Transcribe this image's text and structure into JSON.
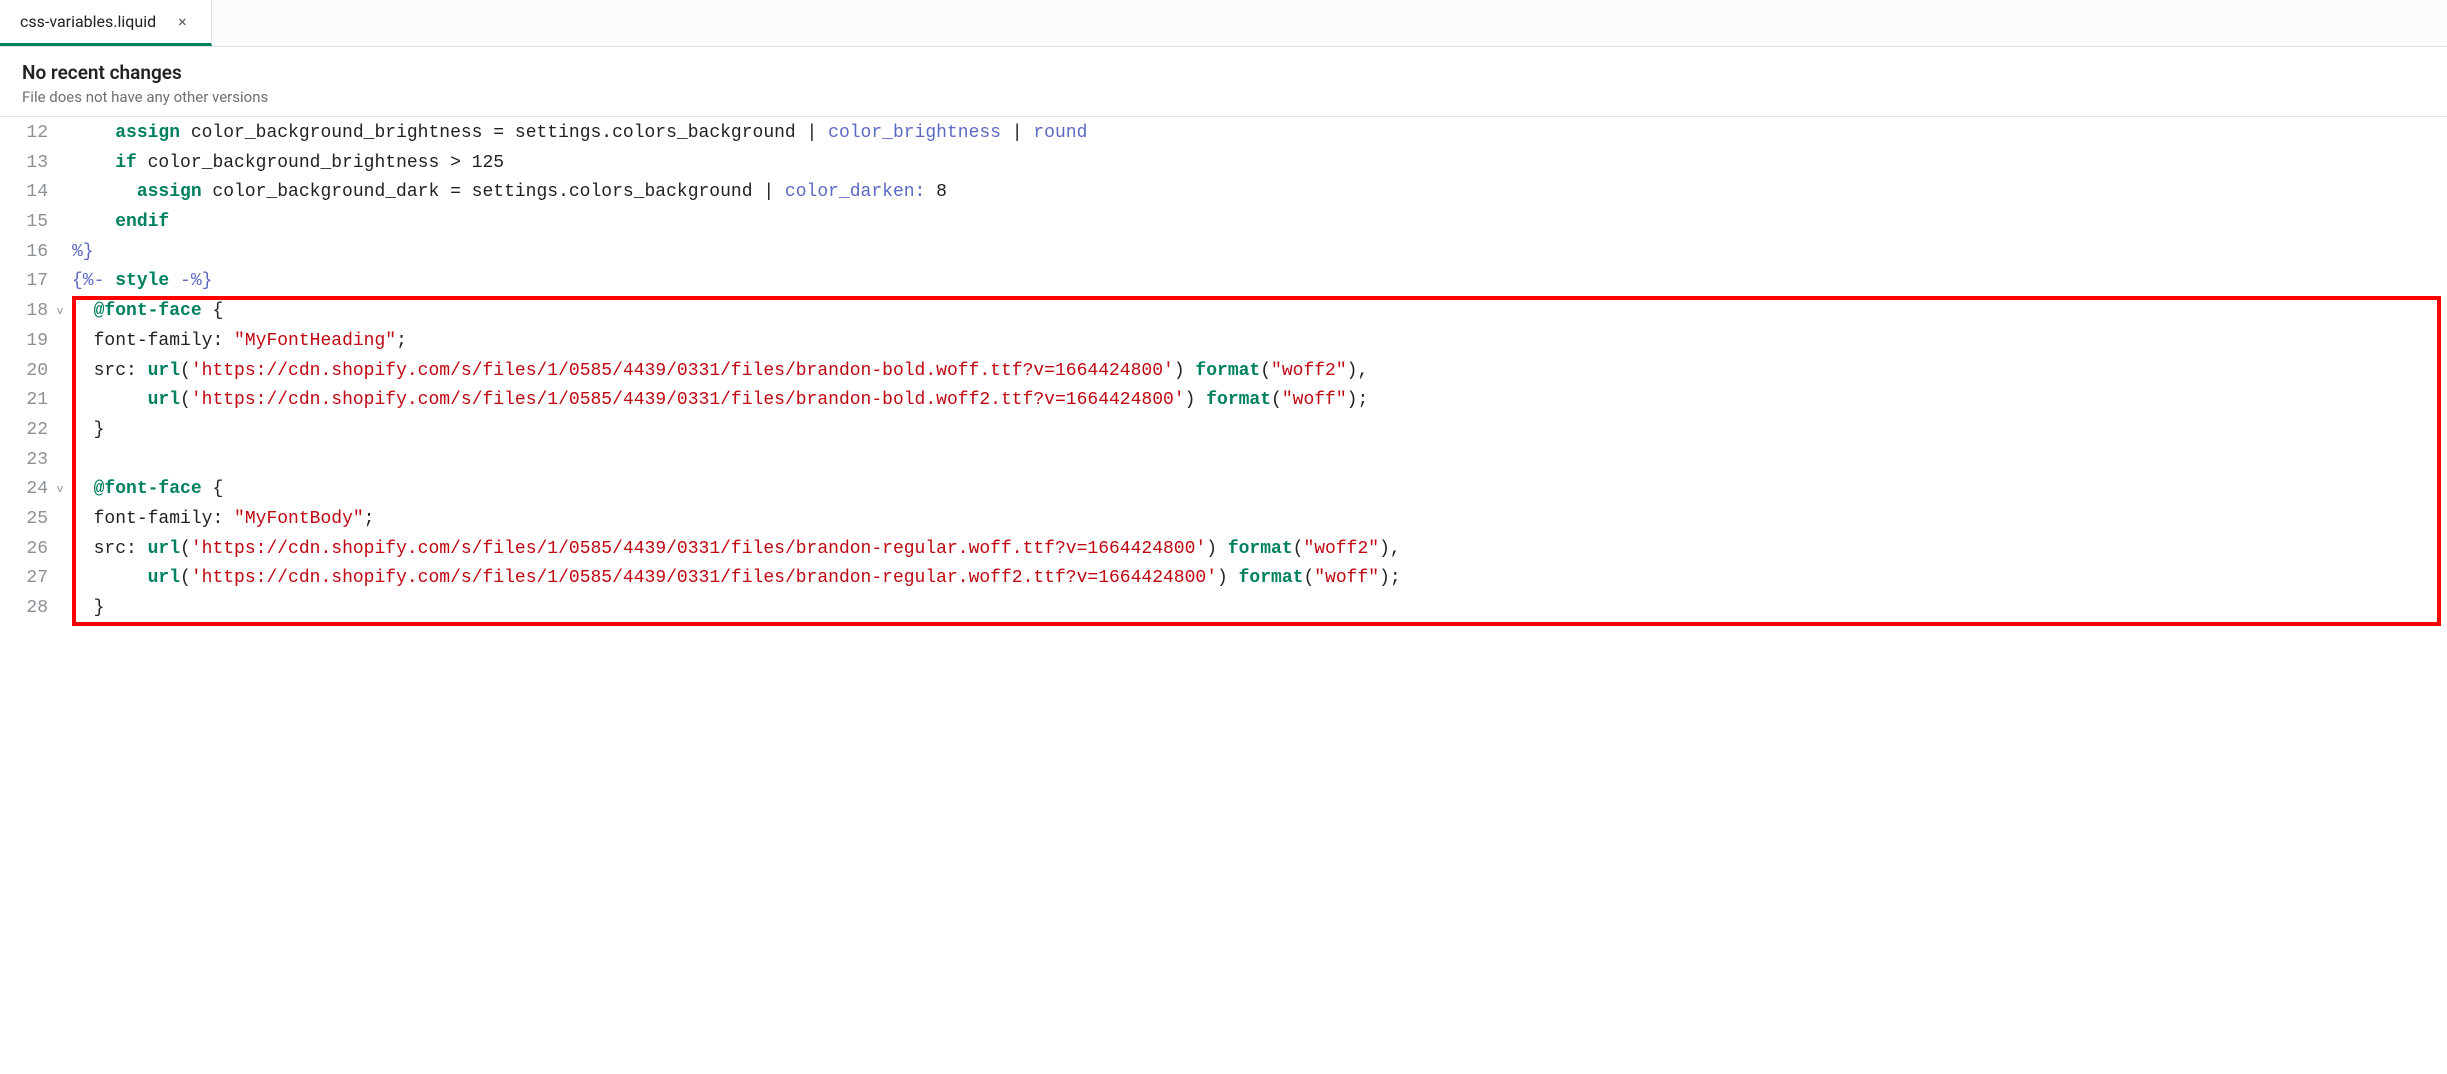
{
  "tab": {
    "label": "css-variables.liquid",
    "close": "×"
  },
  "status": {
    "title": "No recent changes",
    "subtitle": "File does not have any other versions"
  },
  "gutter": {
    "l12": "12",
    "l13": "13",
    "l14": "14",
    "l15": "15",
    "l16": "16",
    "l17": "17",
    "l18": "18",
    "l19": "19",
    "l20": "20",
    "l21": "21",
    "l22": "22",
    "l23": "23",
    "l24": "24",
    "l25": "25",
    "l26": "26",
    "l27": "27",
    "l28": "28"
  },
  "fold": {
    "vmark": "v"
  },
  "code": {
    "l12": {
      "indent": "    ",
      "kw": "assign",
      "a1": " color_background_brightness = settings.colors_background | ",
      "fn1": "color_brightness",
      "a2": " | ",
      "fn2": "round"
    },
    "l13": {
      "indent": "    ",
      "kw": "if",
      "rest": " color_background_brightness > 125"
    },
    "l14": {
      "indent": "      ",
      "kw": "assign",
      "a1": " color_background_dark = settings.colors_background | ",
      "fn": "color_darken:",
      "a2": " 8"
    },
    "l15": {
      "indent": "    ",
      "kw": "endif"
    },
    "l16": {
      "text": "%}"
    },
    "l17": {
      "d1": "{%- ",
      "kw": "style",
      "d2": " -%}"
    },
    "l18": {
      "indent": "  ",
      "rule": "@font-face",
      "rest": " {"
    },
    "l19": {
      "indent": "  ",
      "prop": "font-family",
      "sep": ": ",
      "val": "\"MyFontHeading\"",
      "end": ";"
    },
    "l20": {
      "indent": "  ",
      "prop": "src",
      "sep": ": ",
      "fn1": "url",
      "p1": "(",
      "s1": "'https://cdn.shopify.com/s/files/1/0585/4439/0331/files/brandon-bold.woff.ttf?v=1664424800'",
      "p2": ") ",
      "fn2": "format",
      "p3": "(",
      "s2": "\"woff2\"",
      "p4": "),"
    },
    "l21": {
      "indent": "       ",
      "fn1": "url",
      "p1": "(",
      "s1": "'https://cdn.shopify.com/s/files/1/0585/4439/0331/files/brandon-bold.woff2.ttf?v=1664424800'",
      "p2": ") ",
      "fn2": "format",
      "p3": "(",
      "s2": "\"woff\"",
      "p4": ");"
    },
    "l22": {
      "indent": "  ",
      "text": "}"
    },
    "l23": {
      "text": ""
    },
    "l24": {
      "indent": "  ",
      "rule": "@font-face",
      "rest": " {"
    },
    "l25": {
      "indent": "  ",
      "prop": "font-family",
      "sep": ": ",
      "val": "\"MyFontBody\"",
      "end": ";"
    },
    "l26": {
      "indent": "  ",
      "prop": "src",
      "sep": ": ",
      "fn1": "url",
      "p1": "(",
      "s1": "'https://cdn.shopify.com/s/files/1/0585/4439/0331/files/brandon-regular.woff.ttf?v=1664424800'",
      "p2": ") ",
      "fn2": "format",
      "p3": "(",
      "s2": "\"woff2\"",
      "p4": "),"
    },
    "l27": {
      "indent": "       ",
      "fn1": "url",
      "p1": "(",
      "s1": "'https://cdn.shopify.com/s/files/1/0585/4439/0331/files/brandon-regular.woff2.ttf?v=1664424800'",
      "p2": ") ",
      "fn2": "format",
      "p3": "(",
      "s2": "\"woff\"",
      "p4": ");"
    },
    "l28": {
      "indent": "  ",
      "text": "}"
    }
  },
  "highlight": {
    "top_line": 18,
    "bottom_line": 28
  }
}
